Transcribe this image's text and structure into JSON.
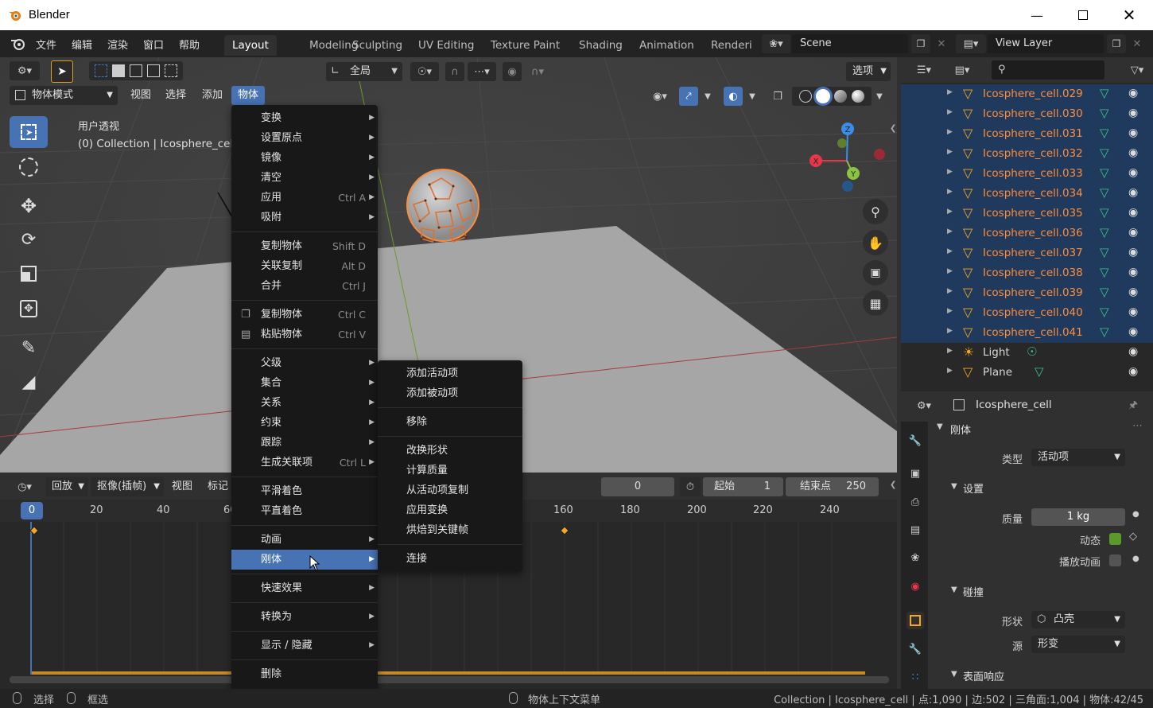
{
  "window": {
    "title": "Blender"
  },
  "topmenu": {
    "file": "文件",
    "edit": "编辑",
    "render": "渲染",
    "window": "窗口",
    "help": "帮助"
  },
  "workspaces": [
    "Layout",
    "Modeling",
    "Sculpting",
    "UV Editing",
    "Texture Paint",
    "Shading",
    "Animation",
    "Renderi"
  ],
  "scene": {
    "name": "Scene",
    "view_layer": "View Layer"
  },
  "viewport": {
    "transform_orientation": "全局",
    "options_label": "选项",
    "mode": "物体模式",
    "menus": {
      "view": "视图",
      "select": "选择",
      "add": "添加",
      "object": "物体"
    },
    "info_line1": "用户透视",
    "info_line2": "(0) Collection | Icosphere_cell",
    "colors": {
      "accent": "#4772b3",
      "selected": "#ff8c3a",
      "x_axis": "#e8364a",
      "y_axis": "#8bc53f",
      "z_axis": "#3a8ee8"
    }
  },
  "object_menu": {
    "items": [
      {
        "label": "变换",
        "shortcut": "",
        "submenu": true
      },
      {
        "label": "设置原点",
        "shortcut": "",
        "submenu": true
      },
      {
        "label": "镜像",
        "shortcut": "",
        "submenu": true
      },
      {
        "label": "清空",
        "shortcut": "",
        "submenu": true
      },
      {
        "label": "应用",
        "shortcut": "Ctrl A",
        "submenu": true
      },
      {
        "label": "吸附",
        "shortcut": "",
        "submenu": true
      },
      {
        "label": "复制物体",
        "shortcut": "Shift D",
        "submenu": false
      },
      {
        "label": "关联复制",
        "shortcut": "Alt D",
        "submenu": false
      },
      {
        "label": "合并",
        "shortcut": "Ctrl J",
        "submenu": false
      },
      {
        "label": "复制物体",
        "shortcut": "Ctrl C",
        "submenu": false
      },
      {
        "label": "粘贴物体",
        "shortcut": "Ctrl V",
        "submenu": false
      },
      {
        "label": "父级",
        "shortcut": "",
        "submenu": true
      },
      {
        "label": "集合",
        "shortcut": "",
        "submenu": true
      },
      {
        "label": "关系",
        "shortcut": "",
        "submenu": true
      },
      {
        "label": "约束",
        "shortcut": "",
        "submenu": true
      },
      {
        "label": "跟踪",
        "shortcut": "",
        "submenu": true
      },
      {
        "label": "生成关联项",
        "shortcut": "Ctrl L",
        "submenu": true
      },
      {
        "label": "平滑着色",
        "shortcut": "",
        "submenu": false
      },
      {
        "label": "平直着色",
        "shortcut": "",
        "submenu": false
      },
      {
        "label": "动画",
        "shortcut": "",
        "submenu": true
      },
      {
        "label": "刚体",
        "shortcut": "",
        "submenu": true
      },
      {
        "label": "快速效果",
        "shortcut": "",
        "submenu": true
      },
      {
        "label": "转换为",
        "shortcut": "",
        "submenu": true
      },
      {
        "label": "显示 / 隐藏",
        "shortcut": "",
        "submenu": true
      },
      {
        "label": "删除",
        "shortcut": "",
        "submenu": false
      }
    ]
  },
  "rigidbody_menu": {
    "items": [
      "添加活动项",
      "添加被动项",
      "移除",
      "改换形状",
      "计算质量",
      "从活动项复制",
      "应用变换",
      "烘焙到关键帧",
      "连接"
    ]
  },
  "timeline": {
    "playback": "回放",
    "keying": "抠像(插帧)",
    "view": "视图",
    "marker": "标记",
    "current_frame": "0",
    "start_label": "起始",
    "start_value": "1",
    "end_label": "结束点",
    "end_value": "250",
    "ticks": [
      "0",
      "20",
      "40",
      "60",
      "160",
      "180",
      "200",
      "220",
      "240"
    ]
  },
  "outliner": {
    "items": [
      {
        "name": "Icosphere_cell.029",
        "selected": true,
        "kind": "mesh"
      },
      {
        "name": "Icosphere_cell.030",
        "selected": true,
        "kind": "mesh"
      },
      {
        "name": "Icosphere_cell.031",
        "selected": true,
        "kind": "mesh"
      },
      {
        "name": "Icosphere_cell.032",
        "selected": true,
        "kind": "mesh"
      },
      {
        "name": "Icosphere_cell.033",
        "selected": true,
        "kind": "mesh"
      },
      {
        "name": "Icosphere_cell.034",
        "selected": true,
        "kind": "mesh"
      },
      {
        "name": "Icosphere_cell.035",
        "selected": true,
        "kind": "mesh"
      },
      {
        "name": "Icosphere_cell.036",
        "selected": true,
        "kind": "mesh"
      },
      {
        "name": "Icosphere_cell.037",
        "selected": true,
        "kind": "mesh"
      },
      {
        "name": "Icosphere_cell.038",
        "selected": true,
        "kind": "mesh"
      },
      {
        "name": "Icosphere_cell.039",
        "selected": true,
        "kind": "mesh"
      },
      {
        "name": "Icosphere_cell.040",
        "selected": true,
        "kind": "mesh"
      },
      {
        "name": "Icosphere_cell.041",
        "selected": true,
        "kind": "mesh"
      },
      {
        "name": "Light",
        "selected": false,
        "kind": "light"
      },
      {
        "name": "Plane",
        "selected": false,
        "kind": "mesh"
      }
    ]
  },
  "properties": {
    "object_name": "Icosphere_cell",
    "rigidbody_title": "刚体",
    "type_label": "类型",
    "type_value": "活动项",
    "settings_title": "设置",
    "mass_label": "质量",
    "mass_value": "1 kg",
    "dynamic_label": "动态",
    "animated_label": "播放动画",
    "collision_title": "碰撞",
    "shape_label": "形状",
    "shape_value": "凸壳",
    "source_label": "源",
    "source_value": "形变",
    "surface_title": "表面响应"
  },
  "statusbar": {
    "select": "选择",
    "box_select": "框选",
    "context_menu": "物体上下文菜单",
    "stats": "Collection | Icosphere_cell | 点:1,090 | 边:502 | 三角面:1,004 | 物体:42/45"
  }
}
